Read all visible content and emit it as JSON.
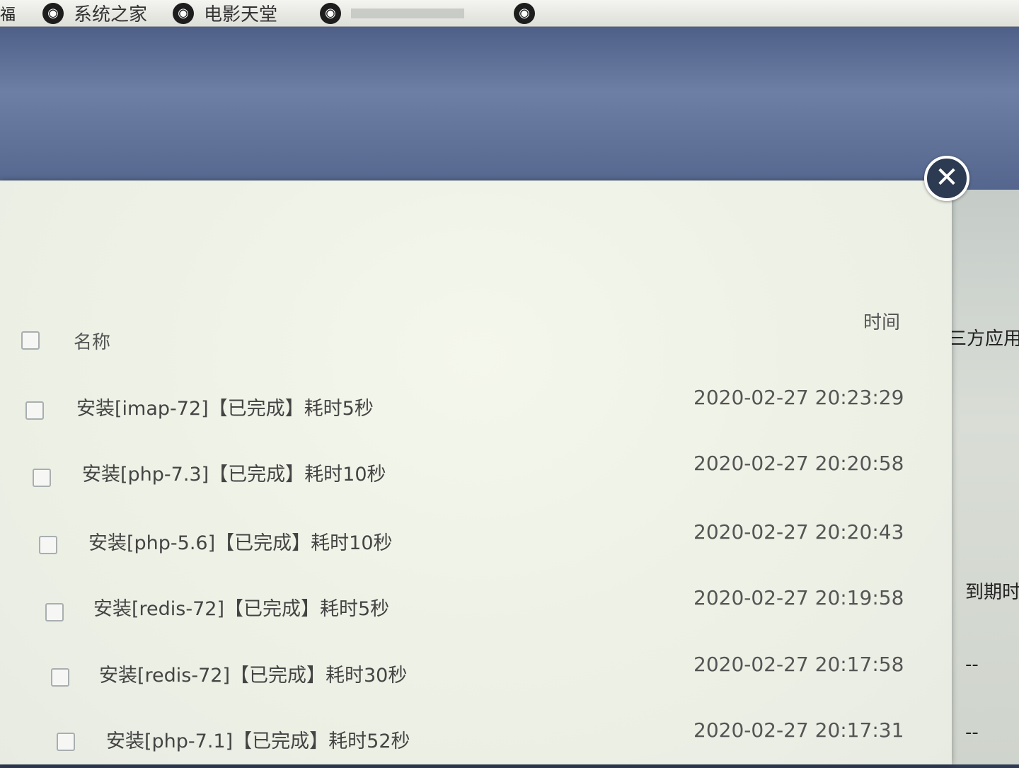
{
  "bookmarks": {
    "edge_text": "福",
    "items": [
      {
        "label": "系统之家",
        "icon": "globe-icon"
      },
      {
        "label": "电影天堂",
        "icon": "globe-icon"
      },
      {
        "label": "",
        "icon": "globe-icon"
      },
      {
        "label": "",
        "icon": "globe-icon"
      }
    ]
  },
  "modal": {
    "close_glyph": "✕",
    "header": {
      "name": "名称",
      "time": "时间"
    },
    "rows": [
      {
        "name": "安装[imap-72]【已完成】耗时5秒",
        "time": "2020-02-27 20:23:29"
      },
      {
        "name": "安装[php-7.3]【已完成】耗时10秒",
        "time": "2020-02-27 20:20:58"
      },
      {
        "name": "安装[php-5.6]【已完成】耗时10秒",
        "time": "2020-02-27 20:20:43"
      },
      {
        "name": "安装[redis-72]【已完成】耗时5秒",
        "time": "2020-02-27 20:19:58"
      },
      {
        "name": "安装[redis-72]【已完成】耗时30秒",
        "time": "2020-02-27 20:17:58"
      },
      {
        "name": "安装[php-7.1]【已完成】耗时52秒",
        "time": "2020-02-27 20:17:31"
      }
    ]
  },
  "background": {
    "right_labels": [
      "三方应用",
      "到期时",
      "--",
      "--"
    ]
  }
}
